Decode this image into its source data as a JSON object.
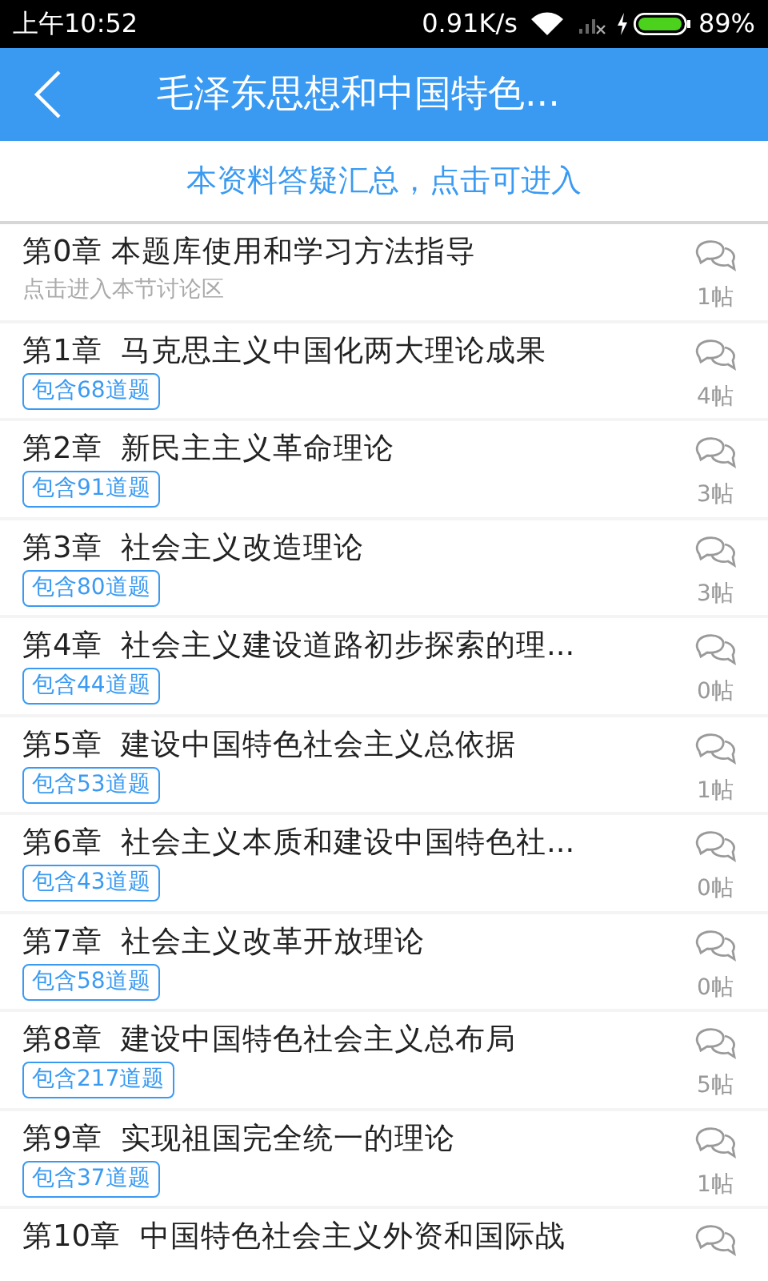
{
  "status_bar": {
    "time": "上午10:52",
    "speed": "0.91K/s",
    "battery": "89%"
  },
  "header": {
    "title": "毛泽东思想和中国特色..."
  },
  "banner": {
    "text": "本资料答疑汇总，点击可进入"
  },
  "chapters": [
    {
      "kind": "note",
      "title": "第0章 本题库使用和学习方法指导",
      "subtitle": "点击进入本节讨论区",
      "posts": "1帖"
    },
    {
      "kind": "tag",
      "title": "第1章  马克思主义中国化两大理论成果",
      "tag": "包含68道题",
      "posts": "4帖"
    },
    {
      "kind": "tag",
      "title": "第2章  新民主主义革命理论",
      "tag": "包含91道题",
      "posts": "3帖"
    },
    {
      "kind": "tag",
      "title": "第3章  社会主义改造理论",
      "tag": "包含80道题",
      "posts": "3帖"
    },
    {
      "kind": "tag",
      "title": "第4章  社会主义建设道路初步探索的理...",
      "tag": "包含44道题",
      "posts": "0帖"
    },
    {
      "kind": "tag",
      "title": "第5章  建设中国特色社会主义总依据",
      "tag": "包含53道题",
      "posts": "1帖"
    },
    {
      "kind": "tag",
      "title": "第6章  社会主义本质和建设中国特色社...",
      "tag": "包含43道题",
      "posts": "0帖"
    },
    {
      "kind": "tag",
      "title": "第7章  社会主义改革开放理论",
      "tag": "包含58道题",
      "posts": "0帖"
    },
    {
      "kind": "tag",
      "title": "第8章  建设中国特色社会主义总布局",
      "tag": "包含217道题",
      "posts": "5帖"
    },
    {
      "kind": "tag",
      "title": "第9章  实现祖国完全统一的理论",
      "tag": "包含37道题",
      "posts": "1帖"
    },
    {
      "kind": "tag",
      "title": "第10章  中国特色社会主义外资和国际战"
    }
  ]
}
